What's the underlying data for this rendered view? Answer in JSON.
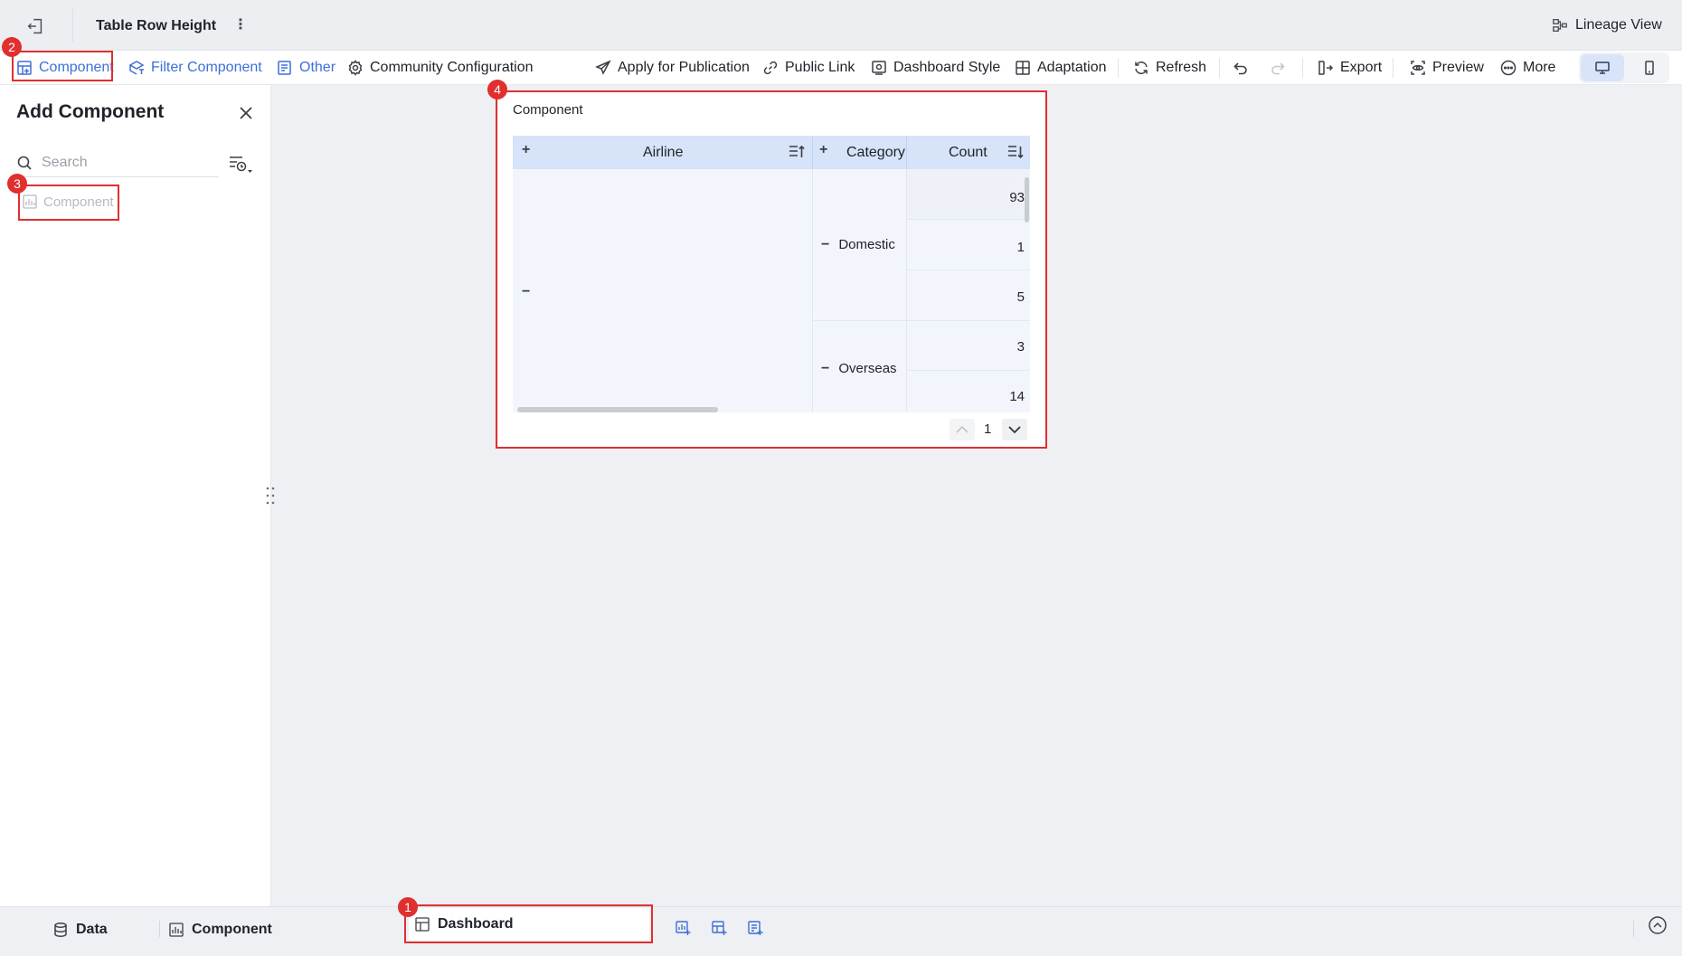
{
  "header": {
    "title": "Table Row Height",
    "lineage_label": "Lineage View"
  },
  "toolbar": {
    "component_label": "Component",
    "filter_component_label": "Filter Component",
    "other_label": "Other",
    "community_config_label": "Community Configuration",
    "apply_publication_label": "Apply for Publication",
    "public_link_label": "Public Link",
    "dashboard_style_label": "Dashboard Style",
    "adaptation_label": "Adaptation",
    "refresh_label": "Refresh",
    "export_label": "Export",
    "preview_label": "Preview",
    "more_label": "More"
  },
  "panel": {
    "title": "Add Component",
    "search_placeholder": "Search",
    "items": [
      {
        "label": "Component"
      }
    ]
  },
  "card": {
    "title": "Component",
    "table": {
      "headers": {
        "airline": "Airline",
        "category": "Category",
        "count": "Count"
      },
      "expand_symbol": "+",
      "collapse_symbol": "−",
      "groups": [
        {
          "category": "Domestic",
          "counts": [
            "93",
            "1",
            "5"
          ]
        },
        {
          "category": "Overseas",
          "counts": [
            "3",
            "14"
          ]
        }
      ]
    },
    "page_number": "1"
  },
  "bottom": {
    "data_label": "Data",
    "component_label": "Component",
    "dashboard_label": "Dashboard"
  },
  "annotations": [
    "1",
    "2",
    "3",
    "4"
  ],
  "colors": {
    "accent_blue": "#3e6fd8",
    "annotation_red": "#e02f2f",
    "header_blue": "#d6e3f8"
  }
}
